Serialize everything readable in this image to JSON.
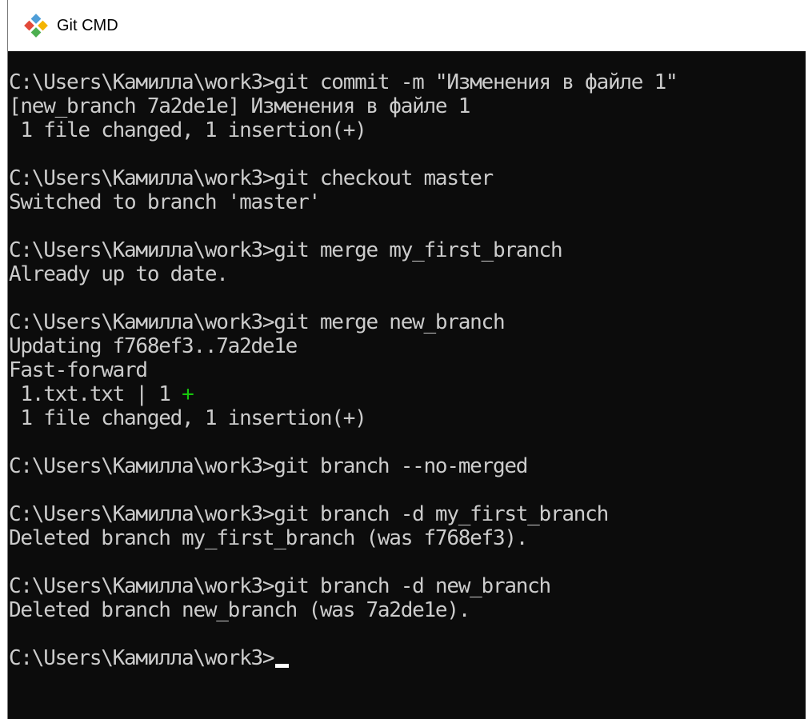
{
  "window": {
    "title": "Git CMD"
  },
  "console": {
    "lines": {
      "l1": "C:\\Users\\Камилла\\work3>git commit -m \"Изменения в файле 1\"",
      "l2": "[new_branch 7a2de1e] Изменения в файле 1",
      "l3": " 1 file changed, 1 insertion(+)",
      "l4": "C:\\Users\\Камилла\\work3>git checkout master",
      "l5": "Switched to branch 'master'",
      "l6": "C:\\Users\\Камилла\\work3>git merge my_first_branch",
      "l7": "Already up to date.",
      "l8": "C:\\Users\\Камилла\\work3>git merge new_branch",
      "l9": "Updating f768ef3..7a2de1e",
      "l10": "Fast-forward",
      "l11_text": " 1.txt.txt | 1 ",
      "l11_plus": "+",
      "l12": " 1 file changed, 1 insertion(+)",
      "l13": "C:\\Users\\Камилла\\work3>git branch --no-merged",
      "l14": "C:\\Users\\Камилла\\work3>git branch -d my_first_branch",
      "l15": "Deleted branch my_first_branch (was f768ef3).",
      "l16": "C:\\Users\\Камилла\\work3>git branch -d new_branch",
      "l17": "Deleted branch new_branch (was 7a2de1e).",
      "prompt": "C:\\Users\\Камилла\\work3>"
    }
  },
  "colors": {
    "console_bg": "#0c0c0c",
    "console_text": "#cccccc",
    "diff_plus": "#16c60c"
  },
  "icons": {
    "app": "git-logo-icon"
  }
}
